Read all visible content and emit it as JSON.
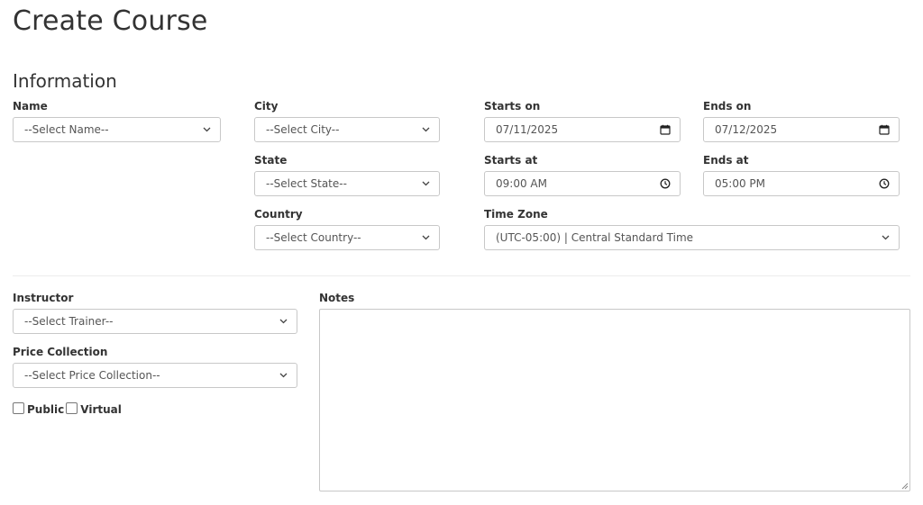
{
  "page": {
    "title": "Create Course"
  },
  "section": {
    "title": "Information"
  },
  "fields": {
    "name": {
      "label": "Name",
      "value": "--Select Name--"
    },
    "city": {
      "label": "City",
      "value": "--Select City--"
    },
    "state": {
      "label": "State",
      "value": "--Select State--"
    },
    "country": {
      "label": "Country",
      "value": "--Select Country--"
    },
    "starts_on": {
      "label": "Starts on",
      "value": "07/11/2025"
    },
    "ends_on": {
      "label": "Ends on",
      "value": "07/12/2025"
    },
    "starts_at": {
      "label": "Starts at",
      "value": "09:00 AM"
    },
    "ends_at": {
      "label": "Ends at",
      "value": "05:00 PM"
    },
    "time_zone": {
      "label": "Time Zone",
      "value": "(UTC-05:00) | Central Standard Time"
    },
    "instructor": {
      "label": "Instructor",
      "value": "--Select Trainer--"
    },
    "price_collection": {
      "label": "Price Collection",
      "value": "--Select Price Collection--"
    },
    "notes": {
      "label": "Notes",
      "value": ""
    }
  },
  "checkboxes": {
    "public": {
      "label": "Public",
      "checked": false
    },
    "virtual": {
      "label": "Virtual",
      "checked": false
    }
  },
  "icons": {
    "select": "chevron-down-icon",
    "date": "calendar-icon",
    "time": "clock-icon"
  }
}
